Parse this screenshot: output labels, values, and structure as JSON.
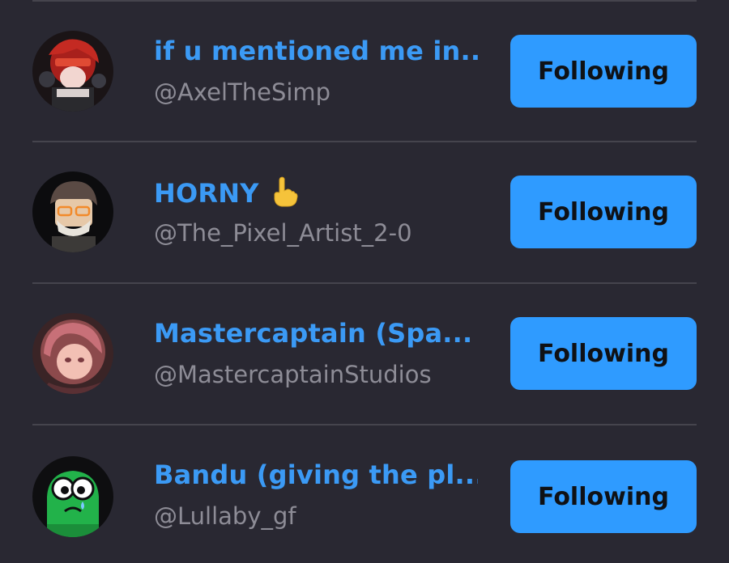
{
  "users": [
    {
      "display_name": "if u mentioned me in...",
      "handle": "@AxelTheSimp",
      "follow_label": "Following"
    },
    {
      "display_name": "HORNY",
      "name_emoji": "pointing-up-hand-icon",
      "handle": "@The_Pixel_Artist_2-0",
      "follow_label": "Following"
    },
    {
      "display_name": "Mastercaptain (Spa...",
      "handle": "@MastercaptainStudios",
      "follow_label": "Following"
    },
    {
      "display_name": "Bandu (giving the pl...",
      "handle": "@Lullaby_gf",
      "follow_label": "Following"
    }
  ],
  "colors": {
    "background": "#292832",
    "name": "#3b9af5",
    "handle": "#8d8c96",
    "button": "#2f9bff",
    "button_text": "#0f1115",
    "divider": "#45444d"
  }
}
